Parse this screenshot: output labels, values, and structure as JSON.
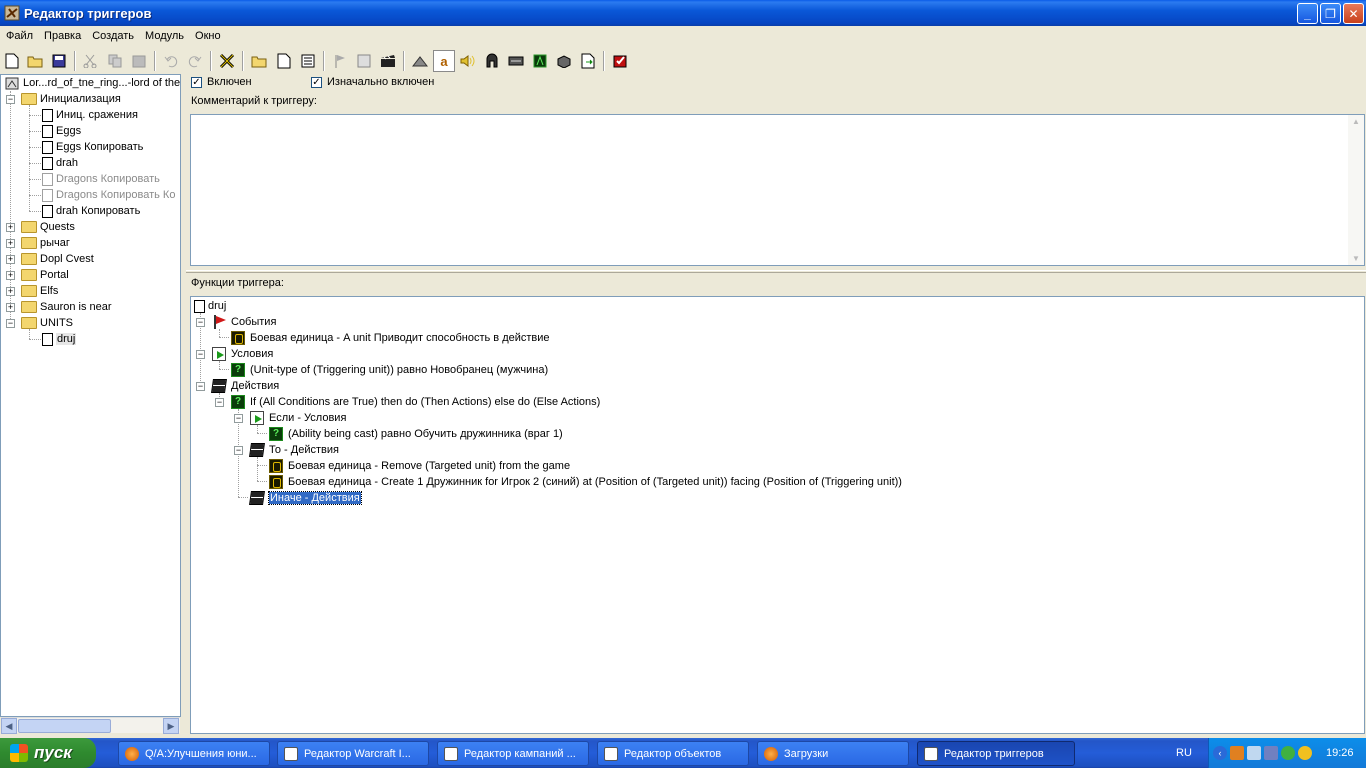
{
  "window": {
    "title": "Редактор триггеров"
  },
  "menu": [
    "Файл",
    "Правка",
    "Создать",
    "Модуль",
    "Окно"
  ],
  "toolbar": {
    "text_button": "a"
  },
  "tree": {
    "root": "Lor...rd_of_tne_ring...-lord of the",
    "items": [
      {
        "label": "Инициализация",
        "type": "folder",
        "expanded": true
      },
      {
        "label": "Иниц. сражения",
        "type": "trigger"
      },
      {
        "label": "Eggs",
        "type": "trigger"
      },
      {
        "label": "Eggs Копировать",
        "type": "trigger"
      },
      {
        "label": "drah",
        "type": "trigger"
      },
      {
        "label": "Dragons Копировать",
        "type": "trigger",
        "disabled": true
      },
      {
        "label": "Dragons Копировать Ко",
        "type": "trigger",
        "disabled": true
      },
      {
        "label": "drah Копировать",
        "type": "trigger"
      },
      {
        "label": "Quests",
        "type": "folder"
      },
      {
        "label": "рычаг",
        "type": "folder"
      },
      {
        "label": "Dopl Cvest",
        "type": "folder"
      },
      {
        "label": "Portal",
        "type": "folder"
      },
      {
        "label": "Elfs",
        "type": "folder"
      },
      {
        "label": "Sauron is near",
        "type": "folder"
      },
      {
        "label": "UNITS",
        "type": "folder",
        "expanded": true
      },
      {
        "label": "druj",
        "type": "trigger",
        "selected": true
      }
    ]
  },
  "trigger": {
    "enabled_label": "Включен",
    "enabled": true,
    "initially_on_label": "Изначально включен",
    "initially_on": true,
    "comment_label": "Комментарий к триггеру:",
    "comment_text": "",
    "functions_label": "Функции триггера:",
    "name": "druj",
    "events_label": "События",
    "event_1": "Боевая единица - A unit Приводит способность в действие",
    "conditions_label": "Условия",
    "condition_1": "(Unit-type of (Triggering unit)) равно Новобранец (мужчина)",
    "actions_label": "Действия",
    "action_if": "If (All Conditions are True) then do (Then Actions) else do (Else Actions)",
    "if_conditions_label": "Если - Условия",
    "if_condition_1": "(Ability being cast) равно Обучить дружинника (враг 1)",
    "then_label": "То - Действия",
    "then_1": "Боевая единица - Remove (Targeted unit) from the game",
    "then_2": "Боевая единица - Create 1 Дружинник for Игрок 2 (синий) at (Position of (Targeted unit)) facing (Position of (Triggering unit))",
    "else_label": "Иначе - Действия"
  },
  "taskbar": {
    "start": "пуск",
    "tasks": [
      "Q/A:Улучшения юни...",
      "Редактор Warcraft I...",
      "Редактор кампаний ...",
      "Редактор объектов",
      "Загрузки",
      "Редактор триггеров"
    ],
    "lang": "RU",
    "clock": "19:26"
  },
  "colors": {
    "selection": "#316ac5",
    "titlebar": "#0a58d8",
    "taskbar": "#245dd8"
  }
}
